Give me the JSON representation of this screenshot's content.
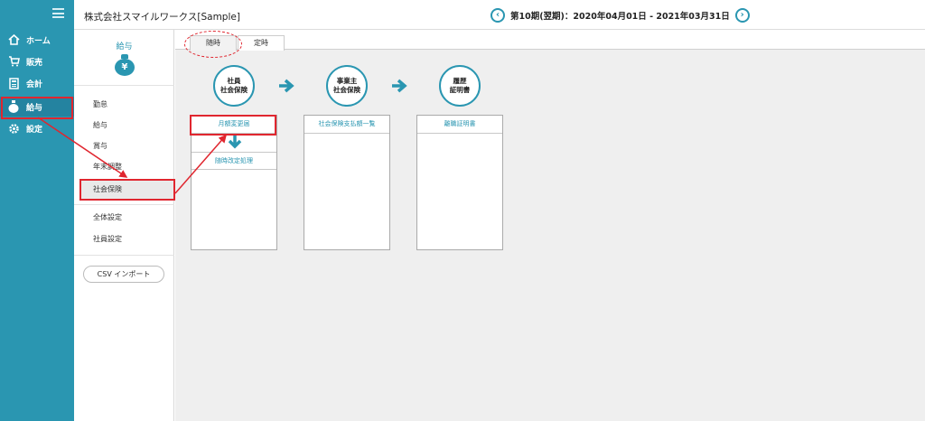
{
  "nav": {
    "items": [
      {
        "label": "ホーム",
        "icon": "home-icon"
      },
      {
        "label": "販売",
        "icon": "cart-icon"
      },
      {
        "label": "会計",
        "icon": "calculator-icon"
      },
      {
        "label": "給与",
        "icon": "money-bag-icon"
      },
      {
        "label": "設定",
        "icon": "gear-icon"
      }
    ]
  },
  "header": {
    "company": "株式会社スマイルワークス[Sample]",
    "period": "第10期(翌期)：2020年04月01日 - 2021年03月31日",
    "prev_icon": "‹",
    "next_icon": "›"
  },
  "subsidebar": {
    "title": "給与",
    "bag_symbol": "¥",
    "items": [
      "勤怠",
      "給与",
      "賞与",
      "年末調整",
      "社会保険",
      "全体設定",
      "社員設定"
    ],
    "csv_button": "CSV インポート"
  },
  "tabs": [
    "随時",
    "定時"
  ],
  "flow": {
    "circles": [
      {
        "line1": "社員",
        "line2": "社会保険"
      },
      {
        "line1": "事業主",
        "line2": "社会保険"
      },
      {
        "line1": "履歴",
        "line2": "証明書"
      }
    ],
    "cards": [
      {
        "rows": [
          "月額変更届",
          "随時改定処理"
        ]
      },
      {
        "rows": [
          "社会保険支払額一覧"
        ]
      },
      {
        "rows": [
          "離職証明書"
        ]
      }
    ]
  },
  "colors": {
    "brand": "#2a96b1",
    "annotation": "#e0262f"
  }
}
